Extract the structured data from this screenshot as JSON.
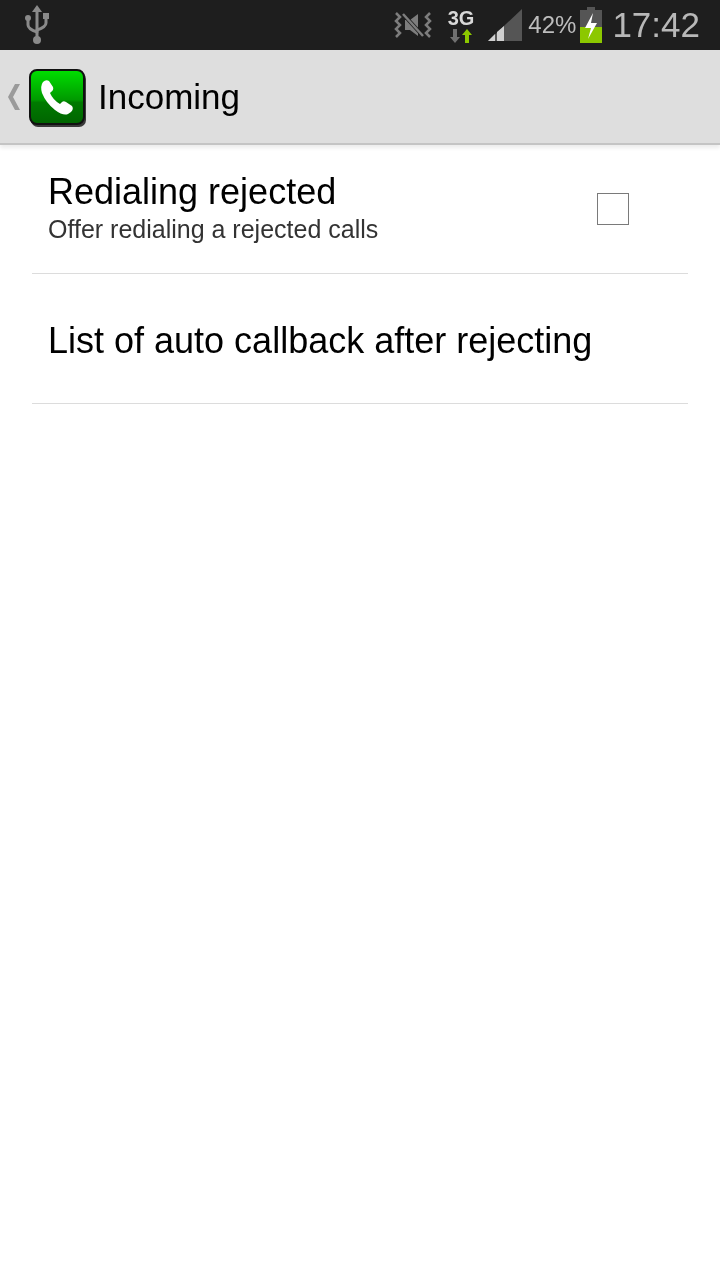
{
  "status_bar": {
    "network": "3G",
    "battery_text": "42%",
    "time": "17:42"
  },
  "action_bar": {
    "title": "Incoming"
  },
  "preferences": [
    {
      "kind": "checkbox",
      "title": "Redialing rejected",
      "summary": "Offer redialing a rejected calls",
      "checked": false
    },
    {
      "kind": "link",
      "title": "List of auto callback after rejecting"
    }
  ]
}
